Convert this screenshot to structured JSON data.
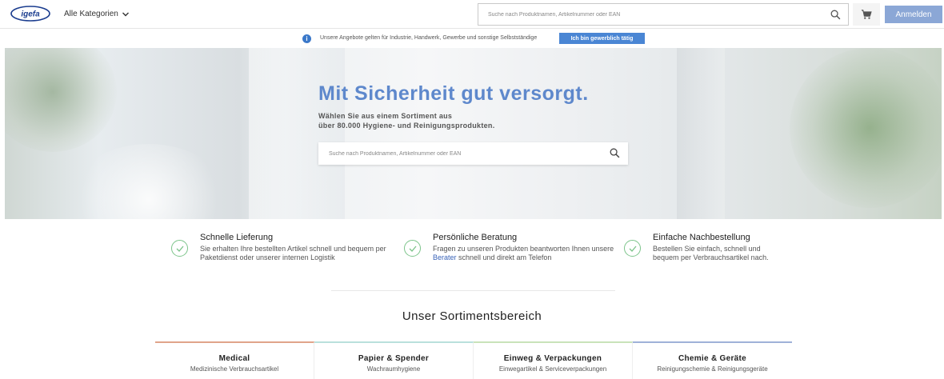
{
  "header": {
    "logo_text": "igefa",
    "categories_label": "Alle Kategorien",
    "search_placeholder": "Suche nach Produktnamen, Artikelnummer oder EAN",
    "login_label": "Anmelden"
  },
  "info_bar": {
    "text": "Unsere Angebote gelten für Industrie, Handwerk, Gewerbe und sonstige Selbstständige",
    "button_label": "Ich bin gewerblich tätig"
  },
  "hero": {
    "title": "Mit Sicherheit gut versorgt.",
    "subtitle_line1": "Wählen Sie aus einem Sortiment aus",
    "subtitle_line2": "über 80.000 Hygiene- und Reinigungsprodukten.",
    "search_placeholder": "Suche nach Produktnamen, Artikelnummer oder EAN"
  },
  "features": [
    {
      "title": "Schnelle Lieferung",
      "text_line1": "Sie erhalten Ihre bestellten Artikel schnell und bequem per",
      "text_line2": "Paketdienst oder unserer internen Logistik"
    },
    {
      "title": "Persönliche Beratung",
      "text_line1": "Fragen zu unseren Produkten beantworten Ihnen unsere",
      "link": "Berater",
      "text_line2_rest": " schnell und direkt am Telefon"
    },
    {
      "title": "Einfache Nachbestellung",
      "text_line1": "Bestellen Sie einfach, schnell und",
      "text_line2": "bequem per Verbrauchsartikel nach."
    }
  ],
  "assortment": {
    "title": "Unser Sortimentsbereich",
    "categories": [
      {
        "title": "Medical",
        "subtitle": "Medizinische Verbrauchsartikel",
        "color": "#e0a48a"
      },
      {
        "title": "Papier & Spender",
        "subtitle": "Wachraumhygiene",
        "color": "#b9e0dc"
      },
      {
        "title": "Einweg & Verpackungen",
        "subtitle": "Einwegartikel & Serviceverpackungen",
        "color": "#c9e3b9"
      },
      {
        "title": "Chemie & Geräte",
        "subtitle": "Reinigungschemie & Reinigungsgeräte",
        "color": "#9fb2d8"
      }
    ]
  },
  "colors": {
    "accent": "#5e88cc",
    "login_button": "#8ba7d6",
    "info_button": "#4a86d4",
    "check": "#7cc48a"
  }
}
